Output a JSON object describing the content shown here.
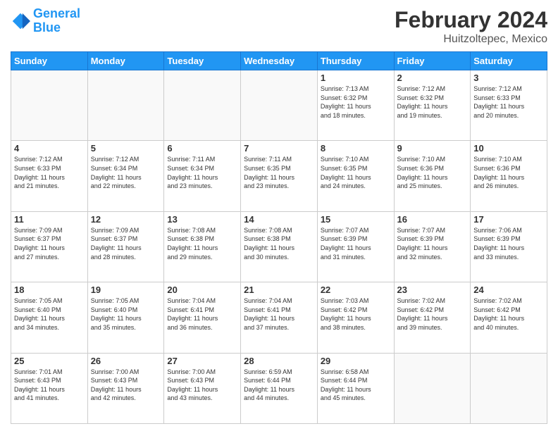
{
  "header": {
    "logo_line1": "General",
    "logo_line2": "Blue",
    "month_year": "February 2024",
    "location": "Huitzoltepec, Mexico"
  },
  "weekdays": [
    "Sunday",
    "Monday",
    "Tuesday",
    "Wednesday",
    "Thursday",
    "Friday",
    "Saturday"
  ],
  "weeks": [
    [
      {
        "day": "",
        "info": ""
      },
      {
        "day": "",
        "info": ""
      },
      {
        "day": "",
        "info": ""
      },
      {
        "day": "",
        "info": ""
      },
      {
        "day": "1",
        "info": "Sunrise: 7:13 AM\nSunset: 6:32 PM\nDaylight: 11 hours\nand 18 minutes."
      },
      {
        "day": "2",
        "info": "Sunrise: 7:12 AM\nSunset: 6:32 PM\nDaylight: 11 hours\nand 19 minutes."
      },
      {
        "day": "3",
        "info": "Sunrise: 7:12 AM\nSunset: 6:33 PM\nDaylight: 11 hours\nand 20 minutes."
      }
    ],
    [
      {
        "day": "4",
        "info": "Sunrise: 7:12 AM\nSunset: 6:33 PM\nDaylight: 11 hours\nand 21 minutes."
      },
      {
        "day": "5",
        "info": "Sunrise: 7:12 AM\nSunset: 6:34 PM\nDaylight: 11 hours\nand 22 minutes."
      },
      {
        "day": "6",
        "info": "Sunrise: 7:11 AM\nSunset: 6:34 PM\nDaylight: 11 hours\nand 23 minutes."
      },
      {
        "day": "7",
        "info": "Sunrise: 7:11 AM\nSunset: 6:35 PM\nDaylight: 11 hours\nand 23 minutes."
      },
      {
        "day": "8",
        "info": "Sunrise: 7:10 AM\nSunset: 6:35 PM\nDaylight: 11 hours\nand 24 minutes."
      },
      {
        "day": "9",
        "info": "Sunrise: 7:10 AM\nSunset: 6:36 PM\nDaylight: 11 hours\nand 25 minutes."
      },
      {
        "day": "10",
        "info": "Sunrise: 7:10 AM\nSunset: 6:36 PM\nDaylight: 11 hours\nand 26 minutes."
      }
    ],
    [
      {
        "day": "11",
        "info": "Sunrise: 7:09 AM\nSunset: 6:37 PM\nDaylight: 11 hours\nand 27 minutes."
      },
      {
        "day": "12",
        "info": "Sunrise: 7:09 AM\nSunset: 6:37 PM\nDaylight: 11 hours\nand 28 minutes."
      },
      {
        "day": "13",
        "info": "Sunrise: 7:08 AM\nSunset: 6:38 PM\nDaylight: 11 hours\nand 29 minutes."
      },
      {
        "day": "14",
        "info": "Sunrise: 7:08 AM\nSunset: 6:38 PM\nDaylight: 11 hours\nand 30 minutes."
      },
      {
        "day": "15",
        "info": "Sunrise: 7:07 AM\nSunset: 6:39 PM\nDaylight: 11 hours\nand 31 minutes."
      },
      {
        "day": "16",
        "info": "Sunrise: 7:07 AM\nSunset: 6:39 PM\nDaylight: 11 hours\nand 32 minutes."
      },
      {
        "day": "17",
        "info": "Sunrise: 7:06 AM\nSunset: 6:39 PM\nDaylight: 11 hours\nand 33 minutes."
      }
    ],
    [
      {
        "day": "18",
        "info": "Sunrise: 7:05 AM\nSunset: 6:40 PM\nDaylight: 11 hours\nand 34 minutes."
      },
      {
        "day": "19",
        "info": "Sunrise: 7:05 AM\nSunset: 6:40 PM\nDaylight: 11 hours\nand 35 minutes."
      },
      {
        "day": "20",
        "info": "Sunrise: 7:04 AM\nSunset: 6:41 PM\nDaylight: 11 hours\nand 36 minutes."
      },
      {
        "day": "21",
        "info": "Sunrise: 7:04 AM\nSunset: 6:41 PM\nDaylight: 11 hours\nand 37 minutes."
      },
      {
        "day": "22",
        "info": "Sunrise: 7:03 AM\nSunset: 6:42 PM\nDaylight: 11 hours\nand 38 minutes."
      },
      {
        "day": "23",
        "info": "Sunrise: 7:02 AM\nSunset: 6:42 PM\nDaylight: 11 hours\nand 39 minutes."
      },
      {
        "day": "24",
        "info": "Sunrise: 7:02 AM\nSunset: 6:42 PM\nDaylight: 11 hours\nand 40 minutes."
      }
    ],
    [
      {
        "day": "25",
        "info": "Sunrise: 7:01 AM\nSunset: 6:43 PM\nDaylight: 11 hours\nand 41 minutes."
      },
      {
        "day": "26",
        "info": "Sunrise: 7:00 AM\nSunset: 6:43 PM\nDaylight: 11 hours\nand 42 minutes."
      },
      {
        "day": "27",
        "info": "Sunrise: 7:00 AM\nSunset: 6:43 PM\nDaylight: 11 hours\nand 43 minutes."
      },
      {
        "day": "28",
        "info": "Sunrise: 6:59 AM\nSunset: 6:44 PM\nDaylight: 11 hours\nand 44 minutes."
      },
      {
        "day": "29",
        "info": "Sunrise: 6:58 AM\nSunset: 6:44 PM\nDaylight: 11 hours\nand 45 minutes."
      },
      {
        "day": "",
        "info": ""
      },
      {
        "day": "",
        "info": ""
      }
    ]
  ]
}
